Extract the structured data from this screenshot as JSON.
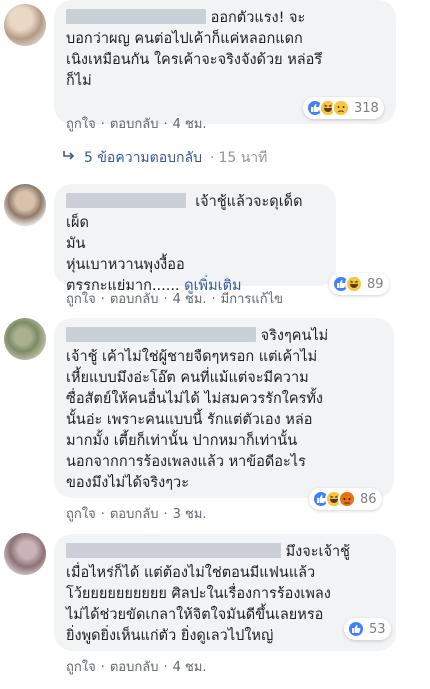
{
  "comments": [
    {
      "text_lines": [
        "ออกตัวแรง! จะ",
        "บอกว่าผญ คนต่อไปเค้าก็แค่หลอกแดก",
        "เนิงเหมือนกัน ใครเค้าจะจริงจังด้วย หล่อรึ",
        "ก็ไม่"
      ],
      "reaction_count": "318",
      "reactions": [
        "like-icon",
        "haha-icon",
        "sad-icon"
      ],
      "like_label": "ถูกใจ",
      "reply_label": "ตอบกลับ",
      "time": "4 ชม."
    },
    {
      "text_lines": [
        "เจ้าชู้แล้วจะดุเด็ดเผ็ด",
        "มัน",
        "หุ่นเบาหวานพุงงื้ออ",
        "ตรรกะแย่มาก......"
      ],
      "see_more": "ดูเพิ่มเติม",
      "reaction_count": "89",
      "reactions": [
        "like-icon",
        "haha-icon"
      ],
      "like_label": "ถูกใจ",
      "reply_label": "ตอบกลับ",
      "time": "4 ชม.",
      "edited": "มีการแก้ไข"
    },
    {
      "text_lines": [
        "จริงๆคนไม่",
        "เจ้าชู้ เค้าไม่ใช่ผู้ชายจืดๆหรอก แต่เค้าไม่",
        "เหี้ยแบบมึงอ่ะโอ๊ต คนที่แม้แต่จะมีความ",
        "ซื่อสัตย์ให้คนอื่นไม่ได้ ไม่สมควรรักใครทั้ง",
        "นั้นอ่ะ เพราะคนแบบนี้ รักแต่ตัวเอง หล่อ",
        "มากมั้ง เตี้ยก็เท่านั้น ปากหมาก็เท่านั้น",
        "นอกจากการร้องเพลงแล้ว หาข้อดีอะไร",
        "ของมึงไม่ได้จริงๆวะ"
      ],
      "reaction_count": "86",
      "reactions": [
        "like-icon",
        "haha-icon",
        "sad-icon"
      ],
      "like_label": "ถูกใจ",
      "reply_label": "ตอบกลับ",
      "time": "3 ชม."
    },
    {
      "text_lines": [
        "มึงจะเจ้าชู้",
        "เมื่อไหร่ก็ได้ แต่ต้องไม่ใช่ตอนมีแฟนแล้ว",
        "โว้ยยยยยยยยยย ศิลปะในเรื่องการร้องเพลง",
        "ไม่ได้ช่วยขัดเกลาให้จิตใจมันดีขึ้นเลยหรอ",
        "ยิ่งพูดยิ่งเห็นแก่ตัว ยิ่งดูเลวไปใหญ่"
      ],
      "reaction_count": "53",
      "reactions": [
        "like-icon"
      ],
      "like_label": "ถูกใจ",
      "reply_label": "ตอบกลับ",
      "time": "4 ชม."
    }
  ],
  "replies_link": {
    "label": "5 ข้อความตอบกลับ",
    "time": "15 นาที"
  },
  "dot": "·",
  "colors": {
    "bubble": "#f2f3f5",
    "link": "#385898",
    "meta": "#606770",
    "like": "#4080ff"
  }
}
